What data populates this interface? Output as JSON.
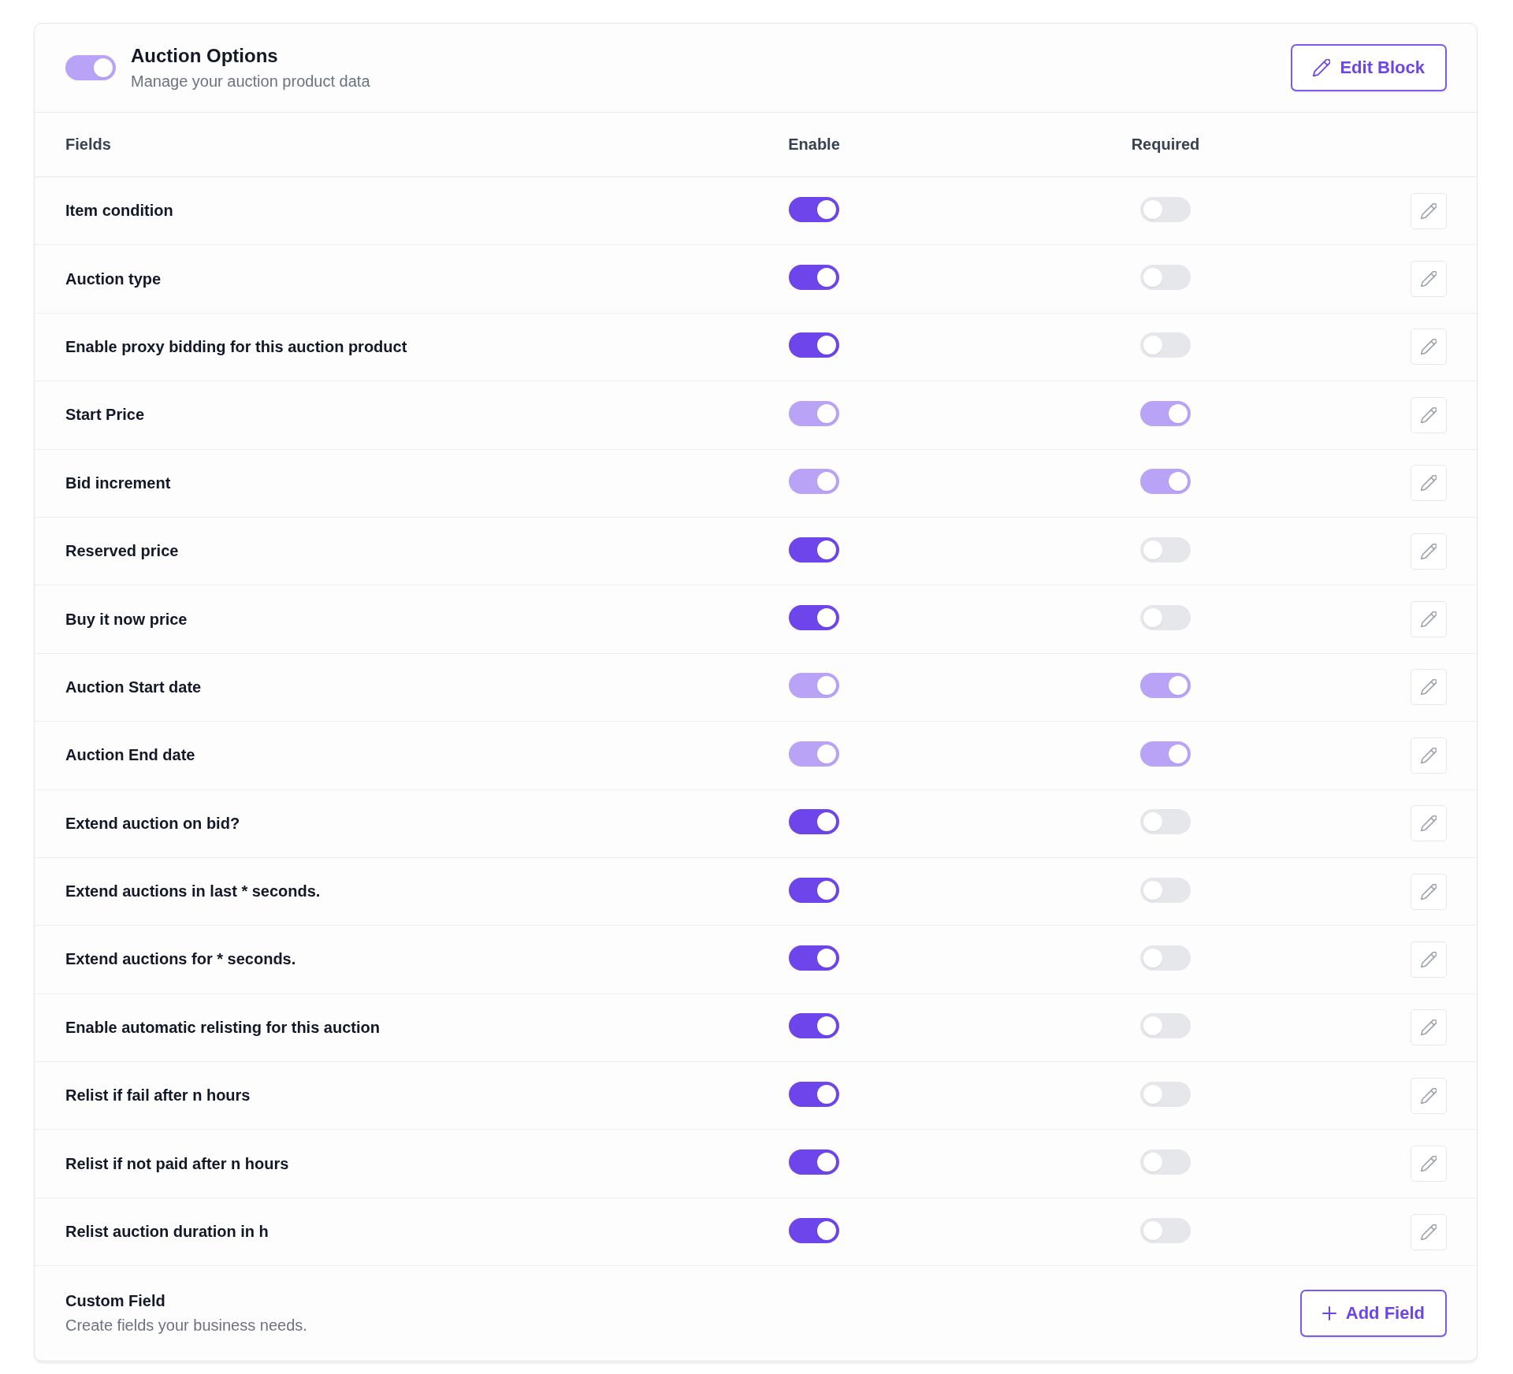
{
  "header": {
    "toggle": {
      "on": true,
      "disabled": true
    },
    "title": "Auction Options",
    "subtitle": "Manage your auction product data",
    "edit_button": "Edit Block"
  },
  "table": {
    "columns": [
      "Fields",
      "Enable",
      "Required"
    ],
    "rows": [
      {
        "label": "Item condition",
        "enable": {
          "on": true,
          "disabled": false
        },
        "required": {
          "on": false,
          "disabled": false
        }
      },
      {
        "label": "Auction type",
        "enable": {
          "on": true,
          "disabled": false
        },
        "required": {
          "on": false,
          "disabled": false
        }
      },
      {
        "label": "Enable proxy bidding for this auction product",
        "enable": {
          "on": true,
          "disabled": false
        },
        "required": {
          "on": false,
          "disabled": false
        }
      },
      {
        "label": "Start Price",
        "enable": {
          "on": true,
          "disabled": true
        },
        "required": {
          "on": true,
          "disabled": true
        }
      },
      {
        "label": "Bid increment",
        "enable": {
          "on": true,
          "disabled": true
        },
        "required": {
          "on": true,
          "disabled": true
        }
      },
      {
        "label": "Reserved price",
        "enable": {
          "on": true,
          "disabled": false
        },
        "required": {
          "on": false,
          "disabled": false
        }
      },
      {
        "label": "Buy it now price",
        "enable": {
          "on": true,
          "disabled": false
        },
        "required": {
          "on": false,
          "disabled": false
        }
      },
      {
        "label": "Auction Start date",
        "enable": {
          "on": true,
          "disabled": true
        },
        "required": {
          "on": true,
          "disabled": true
        }
      },
      {
        "label": "Auction End date",
        "enable": {
          "on": true,
          "disabled": true
        },
        "required": {
          "on": true,
          "disabled": true
        }
      },
      {
        "label": "Extend auction on bid?",
        "enable": {
          "on": true,
          "disabled": false
        },
        "required": {
          "on": false,
          "disabled": false
        }
      },
      {
        "label": "Extend auctions in last * seconds.",
        "enable": {
          "on": true,
          "disabled": false
        },
        "required": {
          "on": false,
          "disabled": false
        }
      },
      {
        "label": "Extend auctions for * seconds.",
        "enable": {
          "on": true,
          "disabled": false
        },
        "required": {
          "on": false,
          "disabled": false
        }
      },
      {
        "label": "Enable automatic relisting for this auction",
        "enable": {
          "on": true,
          "disabled": false
        },
        "required": {
          "on": false,
          "disabled": false
        }
      },
      {
        "label": "Relist if fail after n hours",
        "enable": {
          "on": true,
          "disabled": false
        },
        "required": {
          "on": false,
          "disabled": false
        }
      },
      {
        "label": "Relist if not paid after n hours",
        "enable": {
          "on": true,
          "disabled": false
        },
        "required": {
          "on": false,
          "disabled": false
        }
      },
      {
        "label": "Relist auction duration in h",
        "enable": {
          "on": true,
          "disabled": false
        },
        "required": {
          "on": false,
          "disabled": false
        }
      }
    ]
  },
  "footer": {
    "title": "Custom Field",
    "subtitle": "Create fields your business needs.",
    "add_button": "Add Field"
  }
}
